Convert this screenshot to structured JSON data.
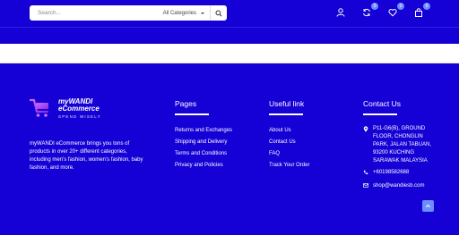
{
  "header": {
    "search": {
      "placeholder": "Search..."
    },
    "category_select": "All Categories",
    "icons": {
      "account": "user-icon",
      "compare": {
        "name": "refresh-icon",
        "count": "0"
      },
      "wishlist": {
        "name": "heart-icon",
        "count": "0"
      },
      "cart": {
        "name": "bag-icon",
        "count": "0"
      }
    }
  },
  "footer": {
    "logo": {
      "line1": "myWANDI",
      "line2": "eCommerce",
      "tagline": "SPEND WISELY"
    },
    "about": "myWANDI eCommerce brings you tons of products in over 20+ different categories, including men’s fashion, women’s fashion, baby fashion, and more.",
    "pages": {
      "title": "Pages",
      "items": [
        "Returns and Exchanges",
        "Shipping and Delivery",
        "Terms and Conditions",
        "Privacy and Policies"
      ]
    },
    "useful": {
      "title": "Useful link",
      "items": [
        "About Us",
        "Contact Us",
        "FAQ",
        "Track Your Order"
      ]
    },
    "contact": {
      "title": "Contact Us",
      "address": "P11-G6(B), GROUND FLOOR, CHONGLIN PARK, JALAN TABUAN, 93200 KUCHING SARAWAK MALAYSIA",
      "phone": "+60198582688",
      "email": "shop@wandiesb.com"
    }
  },
  "colors": {
    "background": "#1500d6",
    "accent": "#6d8cff",
    "text": "#ffffff"
  }
}
